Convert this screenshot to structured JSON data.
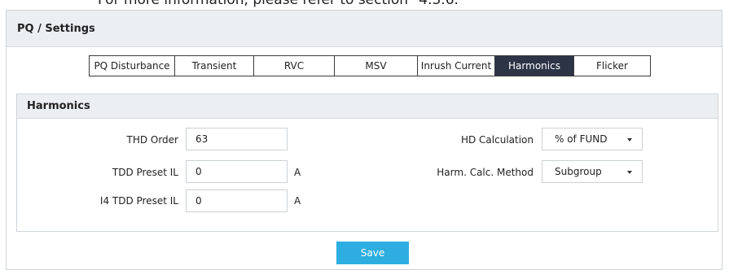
{
  "top_note": "For more information, please refer to section \"4.3.6.\"",
  "panel": {
    "title": "PQ / Settings"
  },
  "tabs": [
    {
      "label": "PQ Disturbance",
      "active": false
    },
    {
      "label": "Transient",
      "active": false
    },
    {
      "label": "RVC",
      "active": false
    },
    {
      "label": "MSV",
      "active": false
    },
    {
      "label": "Inrush Current",
      "active": false
    },
    {
      "label": "Harmonics",
      "active": true
    },
    {
      "label": "Flicker",
      "active": false
    }
  ],
  "section": {
    "title": "Harmonics",
    "thd_order": {
      "label": "THD Order",
      "value": "63"
    },
    "tdd_preset": {
      "label": "TDD Preset IL",
      "value": "0",
      "unit": "A"
    },
    "i4_tdd_preset": {
      "label": "I4 TDD Preset IL",
      "value": "0",
      "unit": "A"
    },
    "hd_calculation": {
      "label": "HD Calculation",
      "value": "% of FUND"
    },
    "harm_method": {
      "label": "Harm. Calc. Method",
      "value": "Subgroup"
    }
  },
  "save_label": "Save",
  "colors": {
    "active_tab": "#2c3446",
    "save_button": "#2eaee0",
    "header_bg": "#eceff2"
  }
}
